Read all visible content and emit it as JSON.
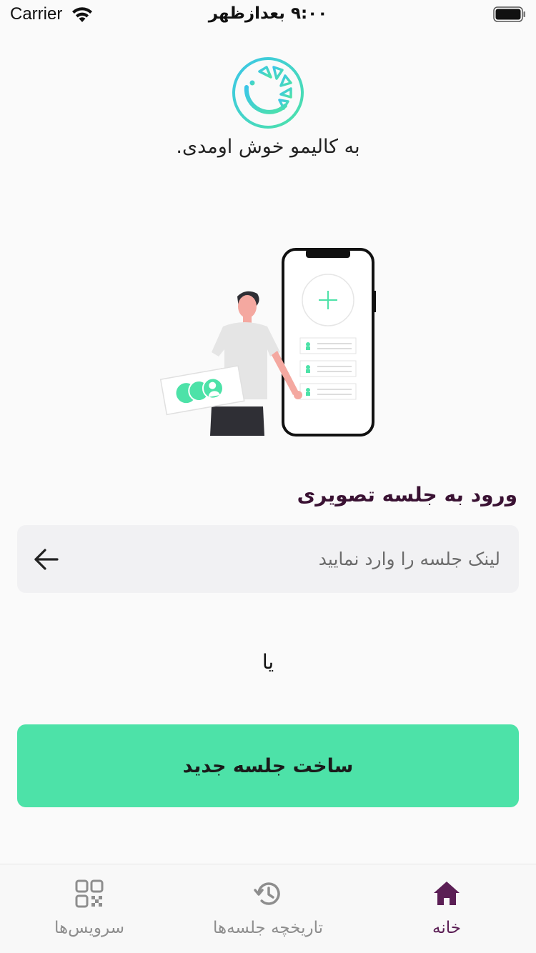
{
  "status_bar": {
    "carrier": "Carrier",
    "time": "۹:۰۰ بعدازظهر"
  },
  "header": {
    "logo_icon": "kalimo-logo-icon",
    "welcome": "به کالیمو خوش اومدی."
  },
  "join": {
    "title": "ورود به جلسه تصویری",
    "input_placeholder": "لینک جلسه را وارد نمایید",
    "input_value": "",
    "submit_icon": "arrow-left-icon"
  },
  "divider_text": "یا",
  "create_button_label": "ساخت جلسه جدید",
  "tab_bar": {
    "items": [
      {
        "label": "سرویس‌ها",
        "icon": "qr-code-icon",
        "active": false
      },
      {
        "label": "تاریخچه جلسه‌ها",
        "icon": "history-icon",
        "active": false
      },
      {
        "label": "خانه",
        "icon": "home-icon",
        "active": true
      }
    ]
  },
  "colors": {
    "accent": "#4de2a8",
    "tab_active": "#5b1f55",
    "title": "#3a1233",
    "tab_inactive": "#8e8e8e"
  }
}
